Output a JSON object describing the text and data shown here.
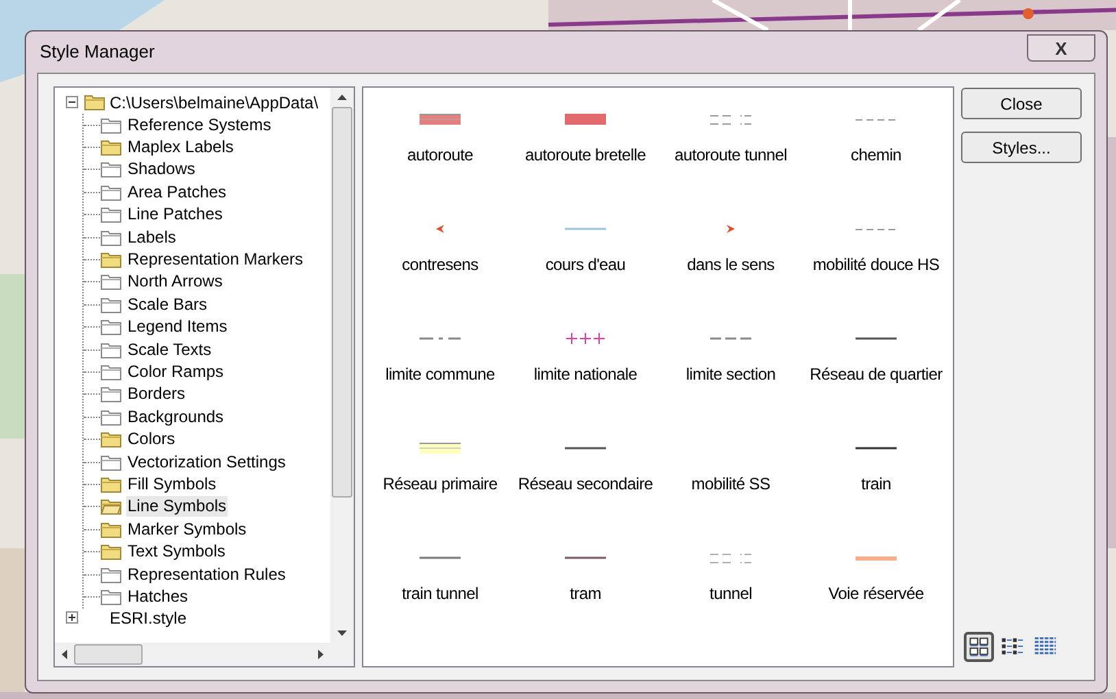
{
  "window": {
    "title": "Style Manager",
    "close_glyph": "X"
  },
  "tree": {
    "root": {
      "label": "C:\\Users\\belmaine\\AppData\\",
      "expanded": true,
      "children": [
        {
          "label": "Reference Systems",
          "filled": false,
          "selected": false
        },
        {
          "label": "Maplex Labels",
          "filled": true,
          "selected": false
        },
        {
          "label": "Shadows",
          "filled": false,
          "selected": false
        },
        {
          "label": "Area Patches",
          "filled": false,
          "selected": false
        },
        {
          "label": "Line Patches",
          "filled": false,
          "selected": false
        },
        {
          "label": "Labels",
          "filled": false,
          "selected": false
        },
        {
          "label": "Representation Markers",
          "filled": true,
          "selected": false
        },
        {
          "label": "North Arrows",
          "filled": false,
          "selected": false
        },
        {
          "label": "Scale Bars",
          "filled": false,
          "selected": false
        },
        {
          "label": "Legend Items",
          "filled": false,
          "selected": false
        },
        {
          "label": "Scale Texts",
          "filled": false,
          "selected": false
        },
        {
          "label": "Color Ramps",
          "filled": false,
          "selected": false
        },
        {
          "label": "Borders",
          "filled": false,
          "selected": false
        },
        {
          "label": "Backgrounds",
          "filled": false,
          "selected": false
        },
        {
          "label": "Colors",
          "filled": true,
          "selected": false
        },
        {
          "label": "Vectorization Settings",
          "filled": false,
          "selected": false
        },
        {
          "label": "Fill Symbols",
          "filled": true,
          "selected": false
        },
        {
          "label": "Line Symbols",
          "filled": true,
          "selected": true
        },
        {
          "label": "Marker Symbols",
          "filled": true,
          "selected": false
        },
        {
          "label": "Text Symbols",
          "filled": true,
          "selected": false
        },
        {
          "label": "Representation Rules",
          "filled": false,
          "selected": false
        },
        {
          "label": "Hatches",
          "filled": false,
          "selected": false
        }
      ]
    },
    "next": {
      "label": "ESRI.style",
      "expanded": false
    }
  },
  "symbols": [
    {
      "label": "autoroute",
      "kind": "band",
      "color": "#e38080"
    },
    {
      "label": "autoroute bretelle",
      "kind": "bar",
      "color": "#e06a6e"
    },
    {
      "label": "autoroute tunnel",
      "kind": "double-dash",
      "color": "#9a9a9a"
    },
    {
      "label": "chemin",
      "kind": "dash",
      "color": "#9a9a9a"
    },
    {
      "label": "contresens",
      "kind": "arrow-left",
      "color": "#e0502a"
    },
    {
      "label": "cours d'eau",
      "kind": "line",
      "color": "#9cc6dc"
    },
    {
      "label": "dans le sens",
      "kind": "arrow-right",
      "color": "#e0502a"
    },
    {
      "label": "mobilité douce HS",
      "kind": "dash",
      "color": "#9a9a9a"
    },
    {
      "label": "limite commune",
      "kind": "dash-dot",
      "color": "#8a8a8a"
    },
    {
      "label": "limite nationale",
      "kind": "cross",
      "color": "#e0409a"
    },
    {
      "label": "limite section",
      "kind": "long-dash",
      "color": "#8a8a8a"
    },
    {
      "label": "Réseau de quartier",
      "kind": "line",
      "color": "#555555"
    },
    {
      "label": "Réseau primaire",
      "kind": "band",
      "color": "#ffffc0"
    },
    {
      "label": "Réseau secondaire",
      "kind": "line",
      "color": "#555555"
    },
    {
      "label": "mobilité SS",
      "kind": "none"
    },
    {
      "label": "train",
      "kind": "line",
      "color": "#333333"
    },
    {
      "label": "train tunnel",
      "kind": "line",
      "color": "#7a7a7a"
    },
    {
      "label": "tram",
      "kind": "line",
      "color": "#7a5a6a"
    },
    {
      "label": "tunnel",
      "kind": "double-dash",
      "color": "#b0b0b0"
    },
    {
      "label": "Voie réservée",
      "kind": "thick",
      "color": "#f4b08a"
    }
  ],
  "buttons": [
    "Close",
    "Styles..."
  ],
  "views": [
    {
      "kind": "icons",
      "selected": true
    },
    {
      "kind": "list",
      "selected": false
    },
    {
      "kind": "details",
      "selected": false
    }
  ]
}
